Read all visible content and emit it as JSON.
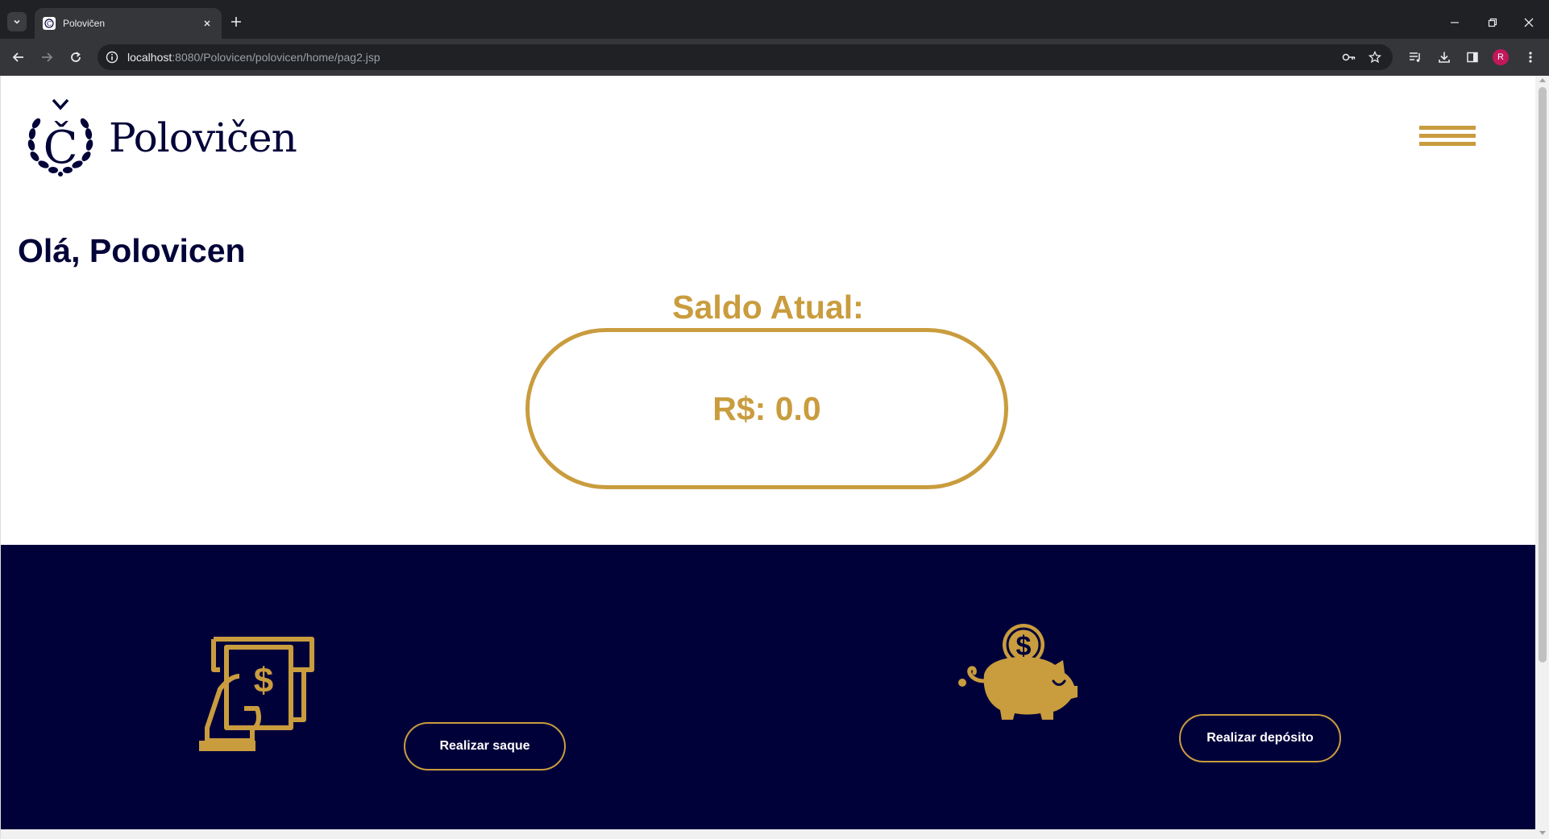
{
  "browser": {
    "tab_title": "Polovičen",
    "url_host": "localhost",
    "url_path": ":8080/Polovicen/polovicen/home/pag2.jsp",
    "profile_initial": "R"
  },
  "header": {
    "logo_text": "Polovičen",
    "logo_letter": "Č"
  },
  "main": {
    "greeting": "Olá, Polovicen",
    "balance_label": "Saldo Atual:",
    "balance_value": "R$: 0.0"
  },
  "actions": {
    "withdraw_label": "Realizar saque",
    "deposit_label": "Realizar depósito"
  },
  "colors": {
    "navy": "#020338",
    "gold": "#c99c3e",
    "panel": "#01013a"
  }
}
